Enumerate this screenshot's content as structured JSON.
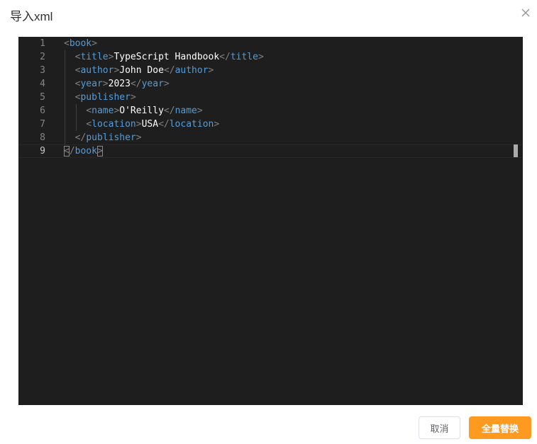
{
  "dialog": {
    "title": "导入xml",
    "close_icon": "close-icon"
  },
  "editor": {
    "line_numbers": [
      "1",
      "2",
      "3",
      "4",
      "5",
      "6",
      "7",
      "8",
      "9"
    ],
    "active_line": 9,
    "lines": [
      {
        "tag": "book",
        "text": "",
        "closing": false
      },
      {
        "tag": "title",
        "text": "TypeScript Handbook",
        "closing": false
      },
      {
        "tag": "author",
        "text": "John Doe",
        "closing": false
      },
      {
        "tag": "year",
        "text": "2023",
        "closing": false
      },
      {
        "tag": "publisher",
        "text": "",
        "closing": false
      },
      {
        "tag": "name",
        "text": "O'Reilly",
        "closing": false
      },
      {
        "tag": "location",
        "text": "USA",
        "closing": false
      },
      {
        "tag": "publisher",
        "text": "",
        "closing": true
      },
      {
        "tag": "book",
        "text": "",
        "closing": true
      }
    ]
  },
  "footer": {
    "cancel_label": "取消",
    "replace_all_label": "全量替换"
  },
  "colors": {
    "editor_bg": "#1e1e1e",
    "tag": "#569cd6",
    "bracket": "#808080",
    "text": "#ffffff",
    "primary": "#ff9a20"
  }
}
